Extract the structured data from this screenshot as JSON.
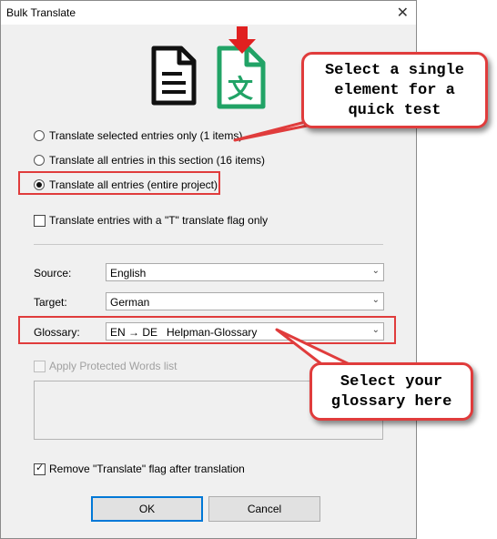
{
  "window": {
    "title": "Bulk Translate",
    "close_glyph": "✕"
  },
  "icons": {
    "document": "document-icon",
    "translate": "translate-file-icon",
    "glyph": "文"
  },
  "options": {
    "selected": "Translate selected entries only (1 items)",
    "section": "Translate all entries in this section (16 items)",
    "all": "Translate all entries (entire project)"
  },
  "t_flag_only": "Translate entries with a \"T\" translate flag only",
  "source": {
    "label": "Source:",
    "value": "English"
  },
  "target": {
    "label": "Target:",
    "value": "German"
  },
  "glossary": {
    "label": "Glossary:",
    "value": "EN → DE   Helpman-Glossary"
  },
  "protected_words": "Apply Protected Words list",
  "remove_flag": "Remove \"Translate\" flag after translation",
  "buttons": {
    "ok": "OK",
    "cancel": "Cancel"
  },
  "callouts": {
    "quick_test": [
      "Select a single",
      "element for a",
      "quick test"
    ],
    "glossary": [
      "Select your",
      "glossary here"
    ]
  },
  "colors": {
    "highlight": "#e03c3c",
    "icon_green": "#21a366",
    "default_button": "#0078d7"
  }
}
